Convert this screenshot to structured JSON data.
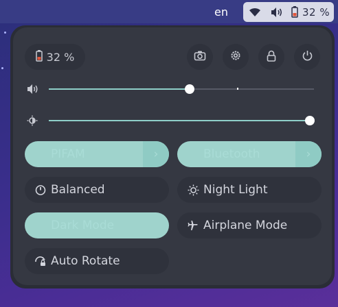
{
  "topbar": {
    "language": "en",
    "battery_percent": "32 %",
    "icons": [
      "wifi-icon",
      "volume-icon",
      "battery-icon"
    ]
  },
  "panel": {
    "battery": {
      "label": "32 %",
      "icon": "battery-icon"
    },
    "header_buttons": [
      "screenshot-icon",
      "settings-icon",
      "lock-icon",
      "power-icon"
    ],
    "volume": {
      "level": 0.53,
      "mark": 0.71,
      "icon": "volume-icon"
    },
    "brightness": {
      "level": 1.0,
      "icon": "brightness-icon"
    },
    "tiles": {
      "wifi": {
        "label": "PIFAM",
        "active": true
      },
      "bluetooth": {
        "label": "Bluetooth",
        "active": true
      },
      "power_mode": {
        "label": "Balanced",
        "icon": "power-mode-icon"
      },
      "night_light": {
        "label": "Night Light",
        "icon": "night-light-icon"
      },
      "dark_mode": {
        "label": "Dark Mode",
        "active": true
      },
      "airplane": {
        "label": "Airplane Mode",
        "icon": "airplane-icon"
      },
      "auto_rotate": {
        "label": "Auto Rotate",
        "icon": "auto-rotate-icon"
      }
    }
  },
  "colors": {
    "accent": "#9fd3cc",
    "panel": "#353842",
    "tile_off": "#2f323c",
    "battery_warning": "#e0553b"
  }
}
